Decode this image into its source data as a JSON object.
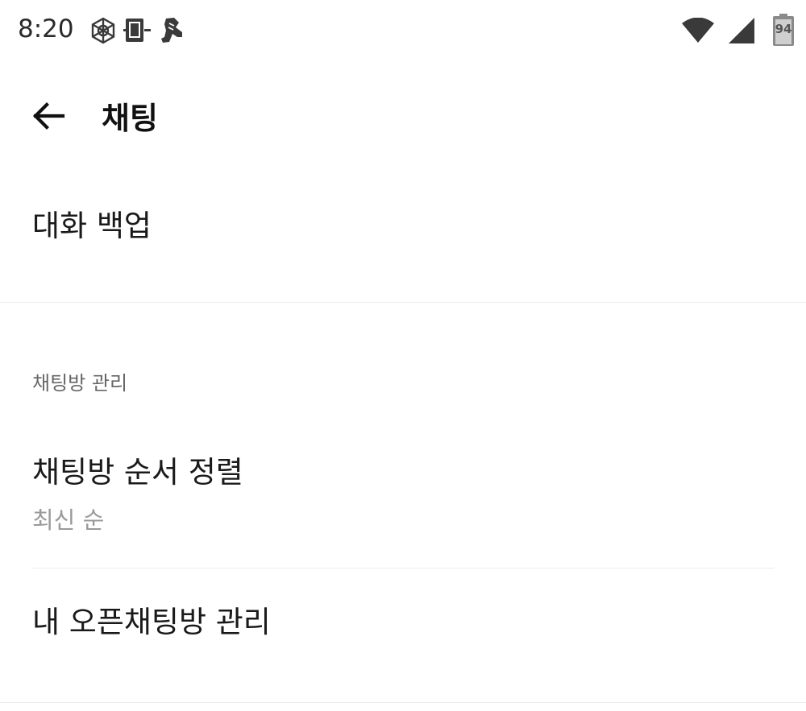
{
  "status_bar": {
    "time": "8:20",
    "battery_level": "94",
    "icons_left": [
      "network-hub-icon",
      "phone-screen-icon",
      "sneaker-icon"
    ],
    "icons_right": [
      "wifi-icon",
      "cellular-signal-icon",
      "battery-icon"
    ]
  },
  "app_bar": {
    "title": "채팅",
    "back_icon": "arrow-left-icon"
  },
  "settings": {
    "backup": {
      "title": "대화 백업"
    },
    "chatroom_section": {
      "header": "채팅방 관리",
      "sort_order": {
        "title": "채팅방 순서 정렬",
        "value": "최신 순"
      },
      "open_chat": {
        "title": "내 오픈채팅방 관리"
      }
    }
  },
  "colors": {
    "background": "#ffffff",
    "divider": "#ececec",
    "primary_text": "#1a1a1a",
    "secondary_text": "#9a9a9a",
    "section_header": "#666666"
  }
}
